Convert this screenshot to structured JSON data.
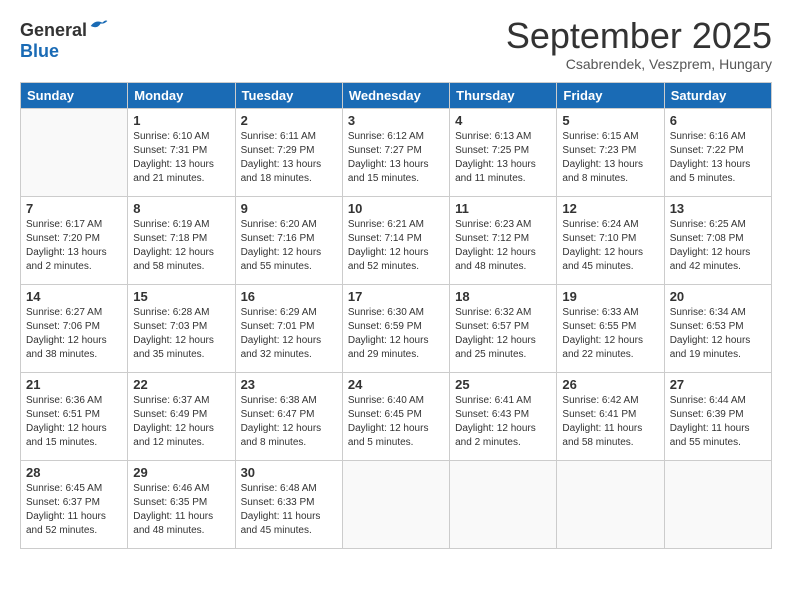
{
  "header": {
    "logo_general": "General",
    "logo_blue": "Blue",
    "month_title": "September 2025",
    "location": "Csabrendek, Veszprem, Hungary"
  },
  "days_of_week": [
    "Sunday",
    "Monday",
    "Tuesday",
    "Wednesday",
    "Thursday",
    "Friday",
    "Saturday"
  ],
  "weeks": [
    [
      {
        "day": "",
        "info": ""
      },
      {
        "day": "1",
        "info": "Sunrise: 6:10 AM\nSunset: 7:31 PM\nDaylight: 13 hours\nand 21 minutes."
      },
      {
        "day": "2",
        "info": "Sunrise: 6:11 AM\nSunset: 7:29 PM\nDaylight: 13 hours\nand 18 minutes."
      },
      {
        "day": "3",
        "info": "Sunrise: 6:12 AM\nSunset: 7:27 PM\nDaylight: 13 hours\nand 15 minutes."
      },
      {
        "day": "4",
        "info": "Sunrise: 6:13 AM\nSunset: 7:25 PM\nDaylight: 13 hours\nand 11 minutes."
      },
      {
        "day": "5",
        "info": "Sunrise: 6:15 AM\nSunset: 7:23 PM\nDaylight: 13 hours\nand 8 minutes."
      },
      {
        "day": "6",
        "info": "Sunrise: 6:16 AM\nSunset: 7:22 PM\nDaylight: 13 hours\nand 5 minutes."
      }
    ],
    [
      {
        "day": "7",
        "info": "Sunrise: 6:17 AM\nSunset: 7:20 PM\nDaylight: 13 hours\nand 2 minutes."
      },
      {
        "day": "8",
        "info": "Sunrise: 6:19 AM\nSunset: 7:18 PM\nDaylight: 12 hours\nand 58 minutes."
      },
      {
        "day": "9",
        "info": "Sunrise: 6:20 AM\nSunset: 7:16 PM\nDaylight: 12 hours\nand 55 minutes."
      },
      {
        "day": "10",
        "info": "Sunrise: 6:21 AM\nSunset: 7:14 PM\nDaylight: 12 hours\nand 52 minutes."
      },
      {
        "day": "11",
        "info": "Sunrise: 6:23 AM\nSunset: 7:12 PM\nDaylight: 12 hours\nand 48 minutes."
      },
      {
        "day": "12",
        "info": "Sunrise: 6:24 AM\nSunset: 7:10 PM\nDaylight: 12 hours\nand 45 minutes."
      },
      {
        "day": "13",
        "info": "Sunrise: 6:25 AM\nSunset: 7:08 PM\nDaylight: 12 hours\nand 42 minutes."
      }
    ],
    [
      {
        "day": "14",
        "info": "Sunrise: 6:27 AM\nSunset: 7:06 PM\nDaylight: 12 hours\nand 38 minutes."
      },
      {
        "day": "15",
        "info": "Sunrise: 6:28 AM\nSunset: 7:03 PM\nDaylight: 12 hours\nand 35 minutes."
      },
      {
        "day": "16",
        "info": "Sunrise: 6:29 AM\nSunset: 7:01 PM\nDaylight: 12 hours\nand 32 minutes."
      },
      {
        "day": "17",
        "info": "Sunrise: 6:30 AM\nSunset: 6:59 PM\nDaylight: 12 hours\nand 29 minutes."
      },
      {
        "day": "18",
        "info": "Sunrise: 6:32 AM\nSunset: 6:57 PM\nDaylight: 12 hours\nand 25 minutes."
      },
      {
        "day": "19",
        "info": "Sunrise: 6:33 AM\nSunset: 6:55 PM\nDaylight: 12 hours\nand 22 minutes."
      },
      {
        "day": "20",
        "info": "Sunrise: 6:34 AM\nSunset: 6:53 PM\nDaylight: 12 hours\nand 19 minutes."
      }
    ],
    [
      {
        "day": "21",
        "info": "Sunrise: 6:36 AM\nSunset: 6:51 PM\nDaylight: 12 hours\nand 15 minutes."
      },
      {
        "day": "22",
        "info": "Sunrise: 6:37 AM\nSunset: 6:49 PM\nDaylight: 12 hours\nand 12 minutes."
      },
      {
        "day": "23",
        "info": "Sunrise: 6:38 AM\nSunset: 6:47 PM\nDaylight: 12 hours\nand 8 minutes."
      },
      {
        "day": "24",
        "info": "Sunrise: 6:40 AM\nSunset: 6:45 PM\nDaylight: 12 hours\nand 5 minutes."
      },
      {
        "day": "25",
        "info": "Sunrise: 6:41 AM\nSunset: 6:43 PM\nDaylight: 12 hours\nand 2 minutes."
      },
      {
        "day": "26",
        "info": "Sunrise: 6:42 AM\nSunset: 6:41 PM\nDaylight: 11 hours\nand 58 minutes."
      },
      {
        "day": "27",
        "info": "Sunrise: 6:44 AM\nSunset: 6:39 PM\nDaylight: 11 hours\nand 55 minutes."
      }
    ],
    [
      {
        "day": "28",
        "info": "Sunrise: 6:45 AM\nSunset: 6:37 PM\nDaylight: 11 hours\nand 52 minutes."
      },
      {
        "day": "29",
        "info": "Sunrise: 6:46 AM\nSunset: 6:35 PM\nDaylight: 11 hours\nand 48 minutes."
      },
      {
        "day": "30",
        "info": "Sunrise: 6:48 AM\nSunset: 6:33 PM\nDaylight: 11 hours\nand 45 minutes."
      },
      {
        "day": "",
        "info": ""
      },
      {
        "day": "",
        "info": ""
      },
      {
        "day": "",
        "info": ""
      },
      {
        "day": "",
        "info": ""
      }
    ]
  ]
}
